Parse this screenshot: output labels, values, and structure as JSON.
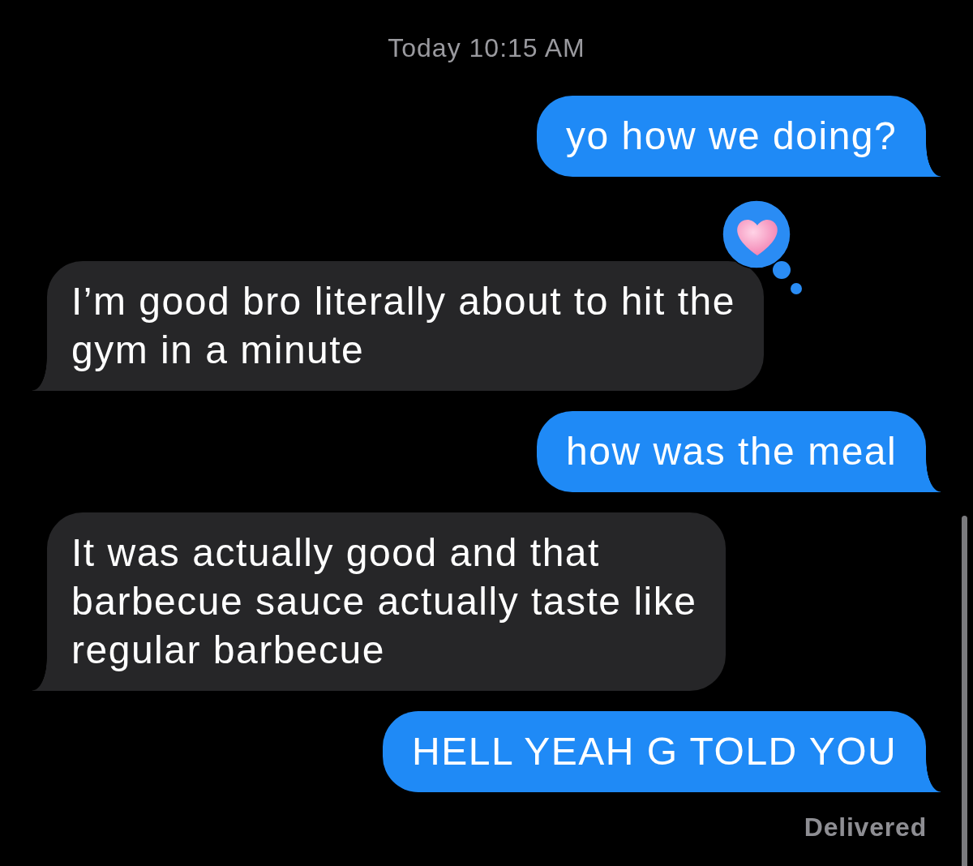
{
  "timestamp": "Today 10:15 AM",
  "messages": [
    {
      "kind": "sent",
      "text": "yo how we doing?",
      "reacted": false
    },
    {
      "kind": "received",
      "text": "I’m good bro literally about to hit the gym in a minute",
      "reacted": true
    },
    {
      "kind": "sent",
      "text": "how was the meal",
      "reacted": false
    },
    {
      "kind": "received",
      "text": "It was actually good and that barbecue sauce actually taste like regular barbecue",
      "reacted": false
    },
    {
      "kind": "sent",
      "text": "HELL YEAH G TOLD YOU",
      "reacted": false
    }
  ],
  "status": "Delivered"
}
